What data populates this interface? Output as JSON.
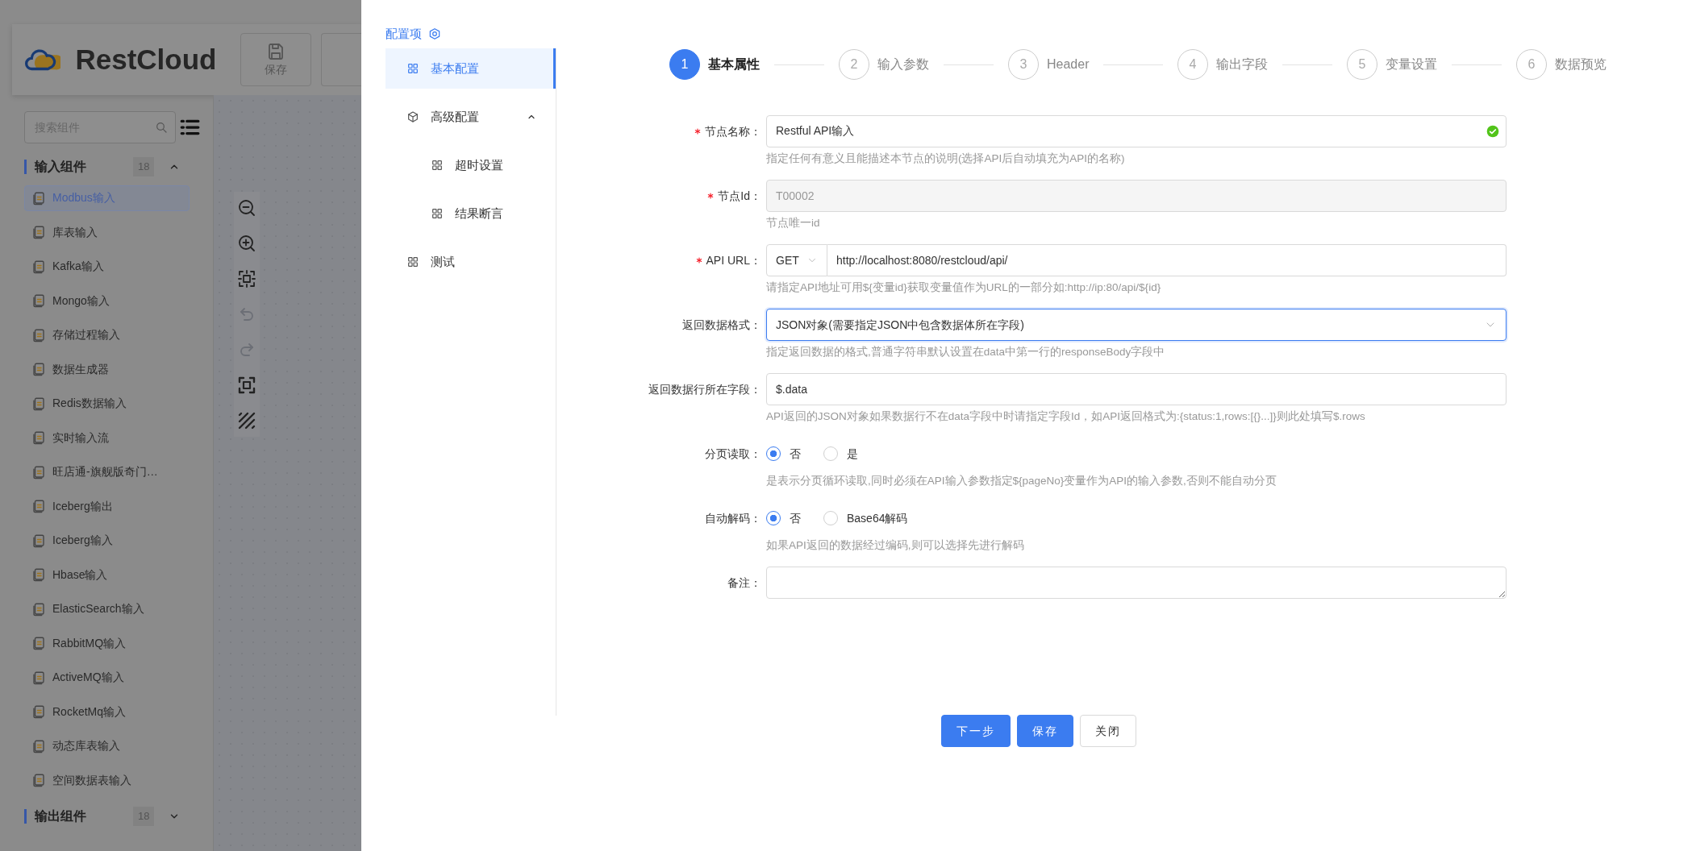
{
  "app": {
    "logo": "RestCloud",
    "toolbar_buttons": [
      {
        "label": "保存"
      }
    ]
  },
  "sidebar": {
    "search": {
      "placeholder": "搜索组件"
    },
    "groups": [
      {
        "title": "输入组件",
        "count": "18",
        "expanded": true,
        "items": [
          {
            "label": "Modbus输入",
            "selected": true
          },
          {
            "label": "库表输入",
            "selected": false
          },
          {
            "label": "Kafka输入",
            "selected": false
          },
          {
            "label": "Mongo输入",
            "selected": false
          },
          {
            "label": "存储过程输入",
            "selected": false
          },
          {
            "label": "数据生成器",
            "selected": false
          },
          {
            "label": "Redis数据输入",
            "selected": false
          },
          {
            "label": "实时输入流",
            "selected": false
          },
          {
            "label": "旺店通-旗舰版奇门…",
            "selected": false
          },
          {
            "label": "Iceberg输出",
            "selected": false
          },
          {
            "label": "Iceberg输入",
            "selected": false
          },
          {
            "label": "Hbase输入",
            "selected": false
          },
          {
            "label": "ElasticSearch输入",
            "selected": false
          },
          {
            "label": "RabbitMQ输入",
            "selected": false
          },
          {
            "label": "ActiveMQ输入",
            "selected": false
          },
          {
            "label": "RocketMq输入",
            "selected": false
          },
          {
            "label": "动态库表输入",
            "selected": false
          },
          {
            "label": "空间数据表输入",
            "selected": false
          }
        ]
      },
      {
        "title": "输出组件",
        "count": "18",
        "expanded": false
      }
    ]
  },
  "config_menu": {
    "title": "配置项",
    "items": [
      {
        "label": "基本配置",
        "selected": true
      },
      {
        "label": "高级配置",
        "selected": false,
        "expanded": true,
        "children": [
          {
            "label": "超时设置",
            "selected": false
          },
          {
            "label": "结果断言",
            "selected": false
          }
        ]
      },
      {
        "label": "测试",
        "selected": false
      }
    ]
  },
  "steps": [
    {
      "number": "1",
      "label": "基本属性",
      "current": true
    },
    {
      "number": "2",
      "label": "输入参数",
      "current": false
    },
    {
      "number": "3",
      "label": "Header",
      "current": false
    },
    {
      "number": "4",
      "label": "输出字段",
      "current": false
    },
    {
      "number": "5",
      "label": "变量设置",
      "current": false
    },
    {
      "number": "6",
      "label": "数据预览",
      "current": false
    }
  ],
  "form": {
    "fields": [
      {
        "kind": "text",
        "label": "节点名称：",
        "required": true,
        "disabled": false,
        "focused": false,
        "valid": true,
        "value": "Restful API输入",
        "help": "指定任何有意义且能描述本节点的说明(选择API后自动填充为API的名称)"
      },
      {
        "kind": "text",
        "label": "节点Id：",
        "required": true,
        "disabled": true,
        "focused": false,
        "valid": false,
        "value": "T00002",
        "help": "节点唯一id"
      },
      {
        "kind": "url",
        "label": "API URL：",
        "required": true,
        "disabled": false,
        "focused": false,
        "valid": false,
        "method": "GET",
        "value": "http://localhost:8080/restcloud/api/",
        "help": "请指定API地址可用${变量id}获取变量值作为URL的一部分如:http://ip:80/api/${id}"
      },
      {
        "kind": "select",
        "label": "返回数据格式：",
        "required": false,
        "disabled": false,
        "focused": true,
        "valid": false,
        "value": "JSON对象(需要指定JSON中包含数据体所在字段)",
        "help": "指定返回数据的格式,普通字符串默认设置在data中第一行的responseBody字段中"
      },
      {
        "kind": "text",
        "label": "返回数据行所在字段：",
        "required": false,
        "disabled": false,
        "focused": false,
        "valid": false,
        "value": "$.data",
        "help": "API返回的JSON对象如果数据行不在data字段中时请指定字段Id，如API返回格式为:{status:1,rows:[{}...]}则此处填写$.rows"
      },
      {
        "kind": "radio",
        "label": "分页读取：",
        "required": false,
        "options": [
          {
            "label": "否",
            "selected": true
          },
          {
            "label": "是",
            "selected": false
          }
        ],
        "help": "是表示分页循环读取,同时必须在API输入参数指定${pageNo}变量作为API的输入参数,否则不能自动分页"
      },
      {
        "kind": "radio",
        "label": "自动解码：",
        "required": false,
        "options": [
          {
            "label": "否",
            "selected": true
          },
          {
            "label": "Base64解码",
            "selected": false
          }
        ],
        "help": "如果API返回的数据经过编码,则可以选择先进行解码"
      },
      {
        "kind": "textarea",
        "label": "备注：",
        "required": false,
        "disabled": false,
        "focused": false,
        "valid": false
      }
    ]
  },
  "buttons": [
    {
      "label": "下一步",
      "kind": "primary"
    },
    {
      "label": "保存",
      "kind": "primary"
    },
    {
      "label": "关闭",
      "kind": "default"
    }
  ]
}
